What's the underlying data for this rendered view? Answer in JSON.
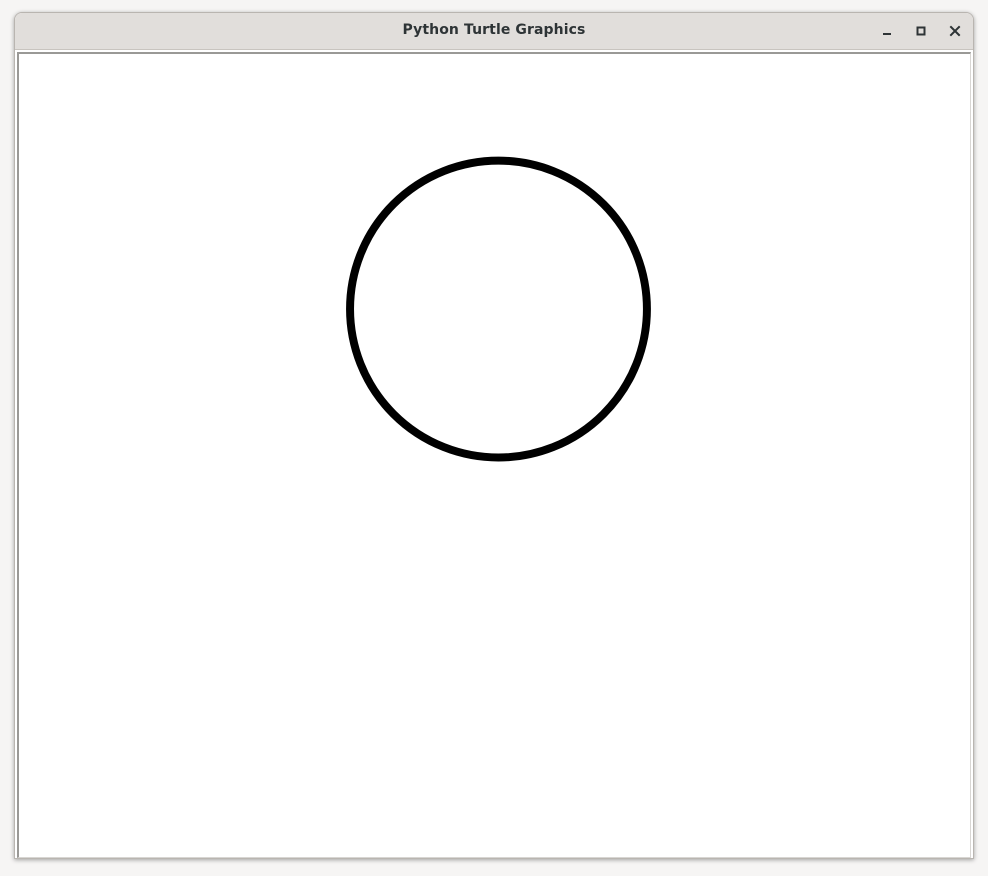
{
  "window": {
    "title": "Python Turtle Graphics"
  },
  "controls": {
    "minimize_icon": "minimize-icon",
    "maximize_icon": "maximize-icon",
    "close_icon": "close-icon"
  },
  "canvas": {
    "background": "#ffffff",
    "drawing": {
      "shape": "circle",
      "stroke_color": "#000000",
      "fill": "none"
    }
  }
}
